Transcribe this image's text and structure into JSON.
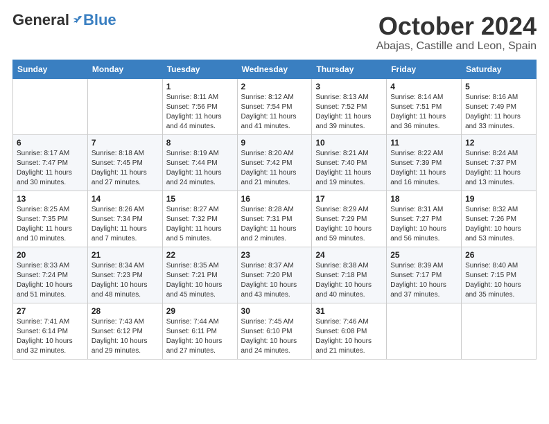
{
  "header": {
    "logo_general": "General",
    "logo_blue": "Blue",
    "month_title": "October 2024",
    "location": "Abajas, Castille and Leon, Spain"
  },
  "weekdays": [
    "Sunday",
    "Monday",
    "Tuesday",
    "Wednesday",
    "Thursday",
    "Friday",
    "Saturday"
  ],
  "weeks": [
    [
      {
        "day": "",
        "info": ""
      },
      {
        "day": "",
        "info": ""
      },
      {
        "day": "1",
        "info": "Sunrise: 8:11 AM\nSunset: 7:56 PM\nDaylight: 11 hours and 44 minutes."
      },
      {
        "day": "2",
        "info": "Sunrise: 8:12 AM\nSunset: 7:54 PM\nDaylight: 11 hours and 41 minutes."
      },
      {
        "day": "3",
        "info": "Sunrise: 8:13 AM\nSunset: 7:52 PM\nDaylight: 11 hours and 39 minutes."
      },
      {
        "day": "4",
        "info": "Sunrise: 8:14 AM\nSunset: 7:51 PM\nDaylight: 11 hours and 36 minutes."
      },
      {
        "day": "5",
        "info": "Sunrise: 8:16 AM\nSunset: 7:49 PM\nDaylight: 11 hours and 33 minutes."
      }
    ],
    [
      {
        "day": "6",
        "info": "Sunrise: 8:17 AM\nSunset: 7:47 PM\nDaylight: 11 hours and 30 minutes."
      },
      {
        "day": "7",
        "info": "Sunrise: 8:18 AM\nSunset: 7:45 PM\nDaylight: 11 hours and 27 minutes."
      },
      {
        "day": "8",
        "info": "Sunrise: 8:19 AM\nSunset: 7:44 PM\nDaylight: 11 hours and 24 minutes."
      },
      {
        "day": "9",
        "info": "Sunrise: 8:20 AM\nSunset: 7:42 PM\nDaylight: 11 hours and 21 minutes."
      },
      {
        "day": "10",
        "info": "Sunrise: 8:21 AM\nSunset: 7:40 PM\nDaylight: 11 hours and 19 minutes."
      },
      {
        "day": "11",
        "info": "Sunrise: 8:22 AM\nSunset: 7:39 PM\nDaylight: 11 hours and 16 minutes."
      },
      {
        "day": "12",
        "info": "Sunrise: 8:24 AM\nSunset: 7:37 PM\nDaylight: 11 hours and 13 minutes."
      }
    ],
    [
      {
        "day": "13",
        "info": "Sunrise: 8:25 AM\nSunset: 7:35 PM\nDaylight: 11 hours and 10 minutes."
      },
      {
        "day": "14",
        "info": "Sunrise: 8:26 AM\nSunset: 7:34 PM\nDaylight: 11 hours and 7 minutes."
      },
      {
        "day": "15",
        "info": "Sunrise: 8:27 AM\nSunset: 7:32 PM\nDaylight: 11 hours and 5 minutes."
      },
      {
        "day": "16",
        "info": "Sunrise: 8:28 AM\nSunset: 7:31 PM\nDaylight: 11 hours and 2 minutes."
      },
      {
        "day": "17",
        "info": "Sunrise: 8:29 AM\nSunset: 7:29 PM\nDaylight: 10 hours and 59 minutes."
      },
      {
        "day": "18",
        "info": "Sunrise: 8:31 AM\nSunset: 7:27 PM\nDaylight: 10 hours and 56 minutes."
      },
      {
        "day": "19",
        "info": "Sunrise: 8:32 AM\nSunset: 7:26 PM\nDaylight: 10 hours and 53 minutes."
      }
    ],
    [
      {
        "day": "20",
        "info": "Sunrise: 8:33 AM\nSunset: 7:24 PM\nDaylight: 10 hours and 51 minutes."
      },
      {
        "day": "21",
        "info": "Sunrise: 8:34 AM\nSunset: 7:23 PM\nDaylight: 10 hours and 48 minutes."
      },
      {
        "day": "22",
        "info": "Sunrise: 8:35 AM\nSunset: 7:21 PM\nDaylight: 10 hours and 45 minutes."
      },
      {
        "day": "23",
        "info": "Sunrise: 8:37 AM\nSunset: 7:20 PM\nDaylight: 10 hours and 43 minutes."
      },
      {
        "day": "24",
        "info": "Sunrise: 8:38 AM\nSunset: 7:18 PM\nDaylight: 10 hours and 40 minutes."
      },
      {
        "day": "25",
        "info": "Sunrise: 8:39 AM\nSunset: 7:17 PM\nDaylight: 10 hours and 37 minutes."
      },
      {
        "day": "26",
        "info": "Sunrise: 8:40 AM\nSunset: 7:15 PM\nDaylight: 10 hours and 35 minutes."
      }
    ],
    [
      {
        "day": "27",
        "info": "Sunrise: 7:41 AM\nSunset: 6:14 PM\nDaylight: 10 hours and 32 minutes."
      },
      {
        "day": "28",
        "info": "Sunrise: 7:43 AM\nSunset: 6:12 PM\nDaylight: 10 hours and 29 minutes."
      },
      {
        "day": "29",
        "info": "Sunrise: 7:44 AM\nSunset: 6:11 PM\nDaylight: 10 hours and 27 minutes."
      },
      {
        "day": "30",
        "info": "Sunrise: 7:45 AM\nSunset: 6:10 PM\nDaylight: 10 hours and 24 minutes."
      },
      {
        "day": "31",
        "info": "Sunrise: 7:46 AM\nSunset: 6:08 PM\nDaylight: 10 hours and 21 minutes."
      },
      {
        "day": "",
        "info": ""
      },
      {
        "day": "",
        "info": ""
      }
    ]
  ]
}
